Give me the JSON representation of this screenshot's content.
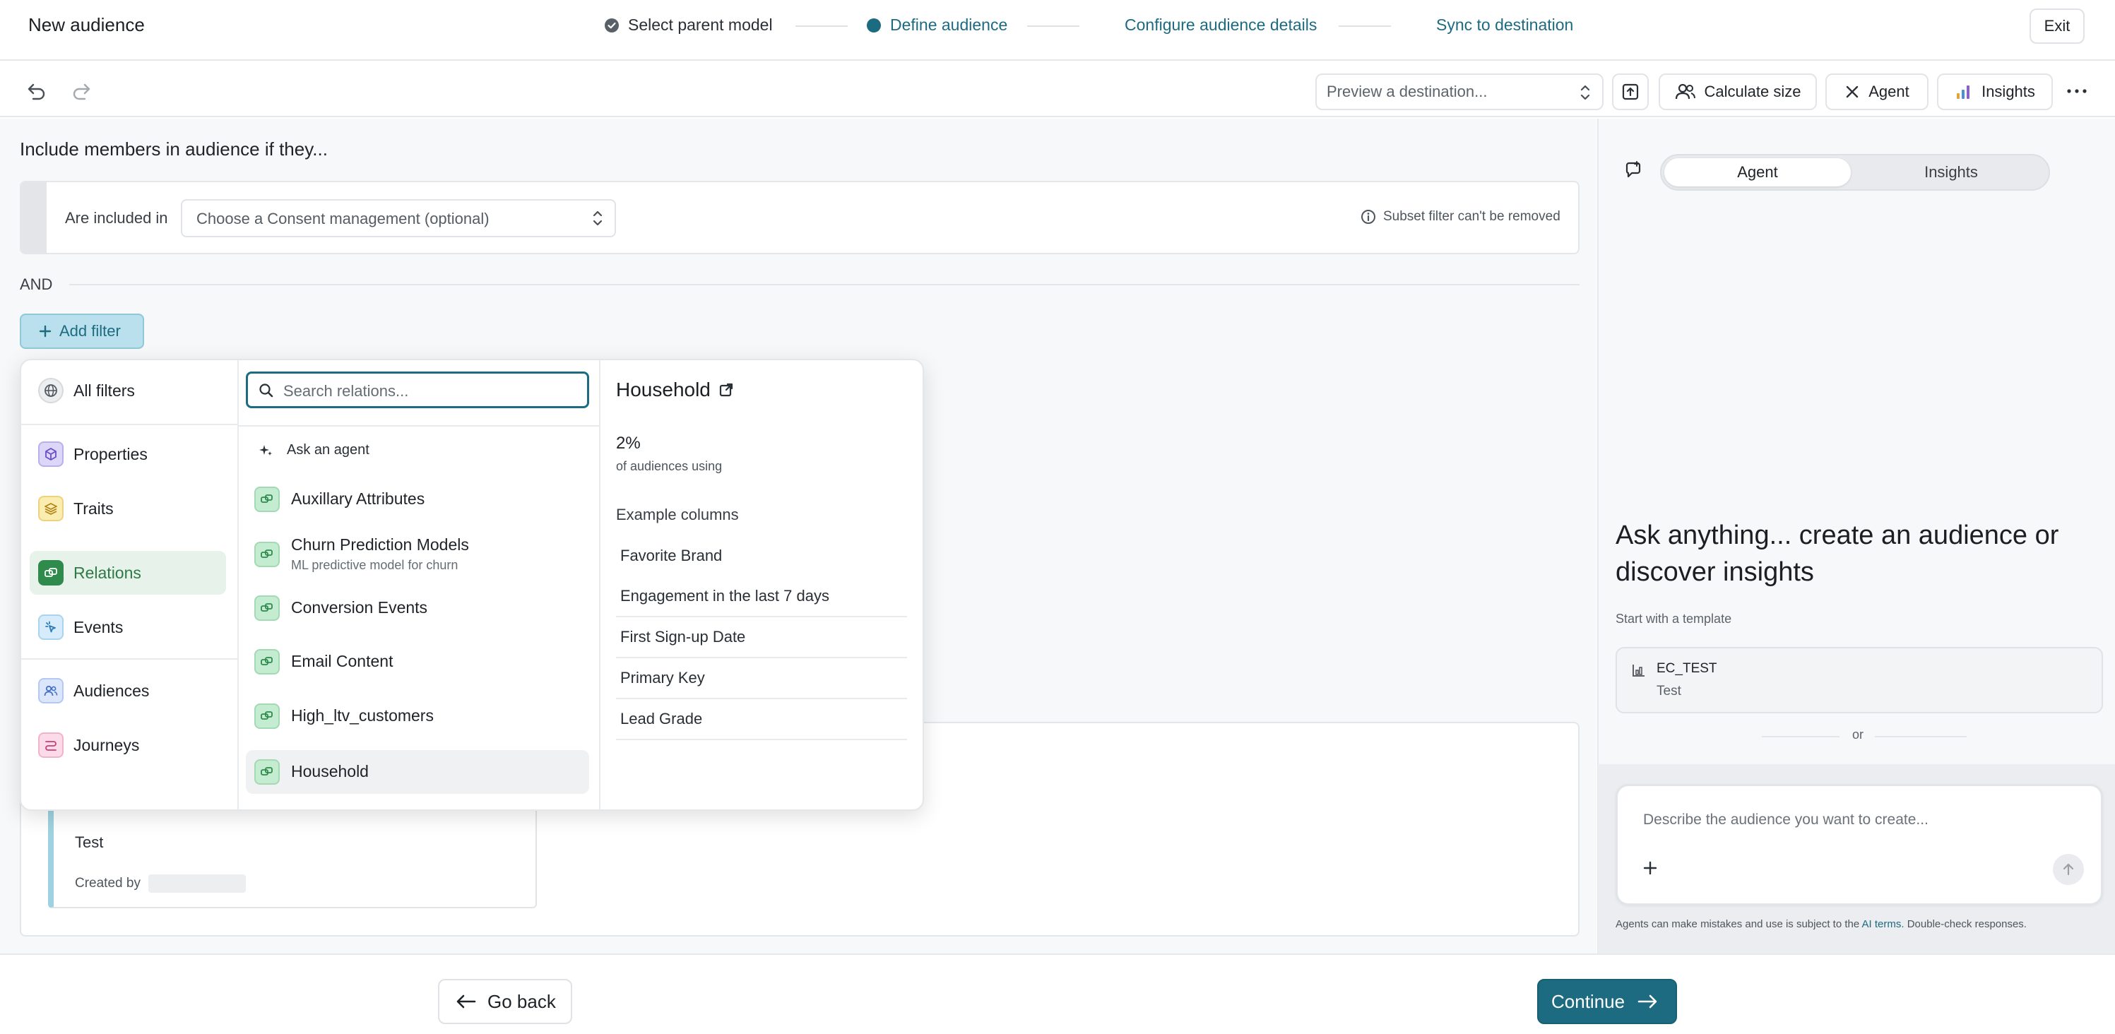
{
  "header": {
    "title": "New audience",
    "steps": [
      {
        "label": "Select parent model",
        "state": "done"
      },
      {
        "label": "Define audience",
        "state": "current"
      },
      {
        "label": "Configure audience details",
        "state": "upcoming"
      },
      {
        "label": "Sync to destination",
        "state": "upcoming"
      }
    ],
    "exit_label": "Exit"
  },
  "toolbar": {
    "destination_placeholder": "Preview a destination...",
    "calculate_label": "Calculate size",
    "agent_label": "Agent",
    "insights_label": "Insights"
  },
  "builder": {
    "heading": "Include members in audience if they...",
    "consent": {
      "label": "Are included in",
      "select_value": "Choose a Consent management (optional)",
      "note": "Subset filter can't be removed"
    },
    "and_label": "AND",
    "add_filter_label": "Add filter"
  },
  "filter_menu": {
    "categories": [
      {
        "label": "All filters",
        "icon": "globe-icon"
      },
      {
        "label": "Properties",
        "icon": "cube-icon"
      },
      {
        "label": "Traits",
        "icon": "layers-icon"
      },
      {
        "label": "Relations",
        "icon": "relations-icon",
        "selected": true
      },
      {
        "label": "Events",
        "icon": "events-icon"
      },
      {
        "label": "Audiences",
        "icon": "users-icon"
      },
      {
        "label": "Journeys",
        "icon": "journey-icon"
      }
    ],
    "search_placeholder": "Search relations...",
    "ask_agent_label": "Ask an agent",
    "relations": [
      {
        "label": "Auxillary Attributes",
        "sub": ""
      },
      {
        "label": "Churn Prediction Models",
        "sub": "ML predictive model for churn"
      },
      {
        "label": "Conversion Events",
        "sub": ""
      },
      {
        "label": "Email Content",
        "sub": ""
      },
      {
        "label": "High_ltv_customers",
        "sub": ""
      },
      {
        "label": "Household",
        "sub": "",
        "hovered": true
      }
    ],
    "detail": {
      "title": "Household",
      "stat_value": "2%",
      "stat_label": "of audiences using",
      "example_heading": "Example columns",
      "columns": [
        "Favorite Brand",
        "Engagement in the last 7 days",
        "First Sign-up Date",
        "Primary Key",
        "Lead Grade"
      ]
    }
  },
  "saved_audience_card": {
    "name": "Test",
    "created_by_label": "Created by"
  },
  "agent_panel": {
    "tabs": [
      "Agent",
      "Insights"
    ],
    "active_tab": "Agent",
    "headline": "Ask anything... create an audience or discover insights",
    "template_label": "Start with a template",
    "template": {
      "title": "EC_TEST",
      "subtitle": "Test"
    },
    "or_label": "or",
    "input_placeholder": "Describe the audience you want to create...",
    "disclaimer_pre": "Agents can make mistakes and use is subject to the",
    "disclaimer_link": "AI terms.",
    "disclaimer_post": "Double-check responses."
  },
  "footer": {
    "back_label": "Go back",
    "continue_label": "Continue"
  },
  "colors": {
    "teal": "#1d6b80",
    "teal_dark": "#195f72",
    "add_filter_bg": "#b9e0ec",
    "relation_green": "#c3ecd0"
  }
}
